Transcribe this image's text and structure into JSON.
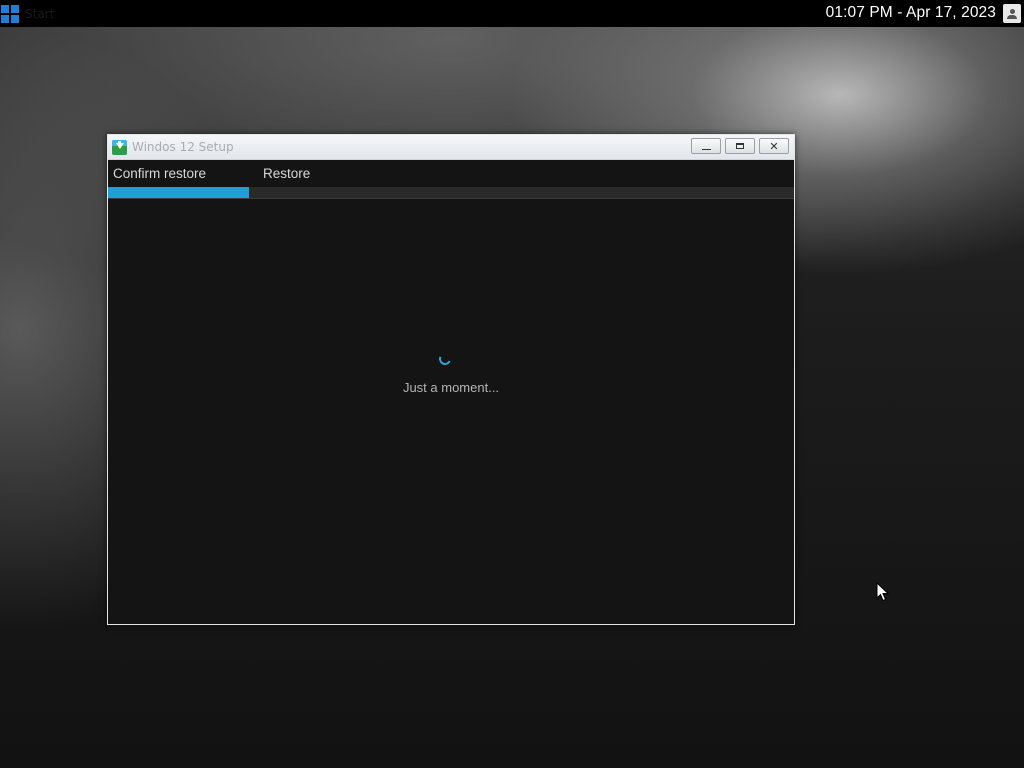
{
  "taskbar": {
    "start_label": "Start",
    "clock": "01:07 PM - Apr 17, 2023",
    "user_icon": "user-icon"
  },
  "window": {
    "title": "Windos 12 Setup",
    "app_icon": "setup-download-icon",
    "controls": {
      "minimize": "minimize-icon",
      "maximize": "maximize-icon",
      "close": "✕"
    },
    "steps": [
      {
        "label": "Confirm restore",
        "active": true
      },
      {
        "label": "Restore",
        "active": false
      }
    ],
    "progress_fraction": 0.205,
    "loading_text": "Just a moment...",
    "accent_color": "#1ea0d6"
  }
}
